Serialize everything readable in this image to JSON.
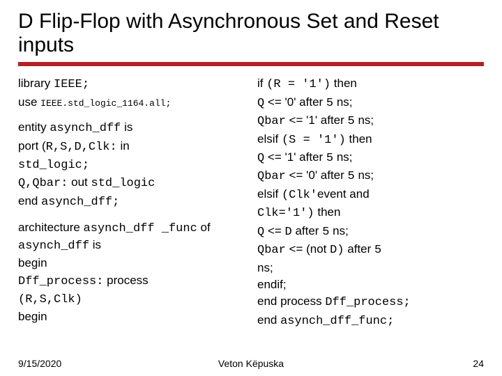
{
  "title": "D Flip-Flop with Asynchronous Set and Reset inputs",
  "left": {
    "l1a": "library ",
    "l1b": "IEEE;",
    "l2a": "use ",
    "l2b": "IEEE.std_logic_1164.all;",
    "l3a": "entity ",
    "l3b": "asynch_dff",
    "l3c": " is",
    "l4a": "port (",
    "l4b": "R,S,D,Clk:",
    "l4c": " in",
    "l5": "std_logic;",
    "l6a": "Q,Qbar:",
    "l6b": " out ",
    "l6c": "std_logic",
    "l7a": "end ",
    "l7b": "asynch_dff;",
    "l8a": "architecture ",
    "l8b": "asynch_dff _func",
    "l8c": " of ",
    "l8d": "asynch_dff",
    "l8e": " is",
    "l9": "begin",
    "l10a": "Dff_process:",
    "l10b": " process",
    "l11": "(R,S,Clk)",
    "l12": "begin"
  },
  "right": {
    "r1a": "if ",
    "r1b": "(R = '1')",
    "r1c": " then",
    "r2a": "Q",
    "r2b": " <= '0' after ",
    "r2c": "5",
    "r2d": " ns;",
    "r3a": "Qbar",
    "r3b": " <= '1' after ",
    "r3c": "5",
    "r3d": " ns;",
    "r4a": "elsif ",
    "r4b": "(S = '1')",
    "r4c": " then",
    "r5a": "Q",
    "r5b": " <= '1' after ",
    "r5c": "5",
    "r5d": " ns;",
    "r6a": "Qbar",
    "r6b": " <= '0' after ",
    "r6c": "5",
    "r6d": " ns;",
    "r7a": "elsif ",
    "r7b": "(Clk'",
    "r7c": "event and",
    "r8a": "Clk='1')",
    "r8b": " then",
    "r9a": "Q",
    "r9b": " <= ",
    "r9c": "D",
    "r9d": " after ",
    "r9e": "5",
    "r9f": " ns;",
    "r10a": "Qbar",
    "r10b": " <= (not ",
    "r10c": "D)",
    "r10d": " after ",
    "r10e": "5",
    "r11": "ns;",
    "r12": "endif;",
    "r13a": "end process ",
    "r13b": "Dff_process;",
    "r14a": "end ",
    "r14b": "asynch_dff_func;"
  },
  "footer": {
    "date": "9/15/2020",
    "author": "Veton Këpuska",
    "page": "24"
  }
}
